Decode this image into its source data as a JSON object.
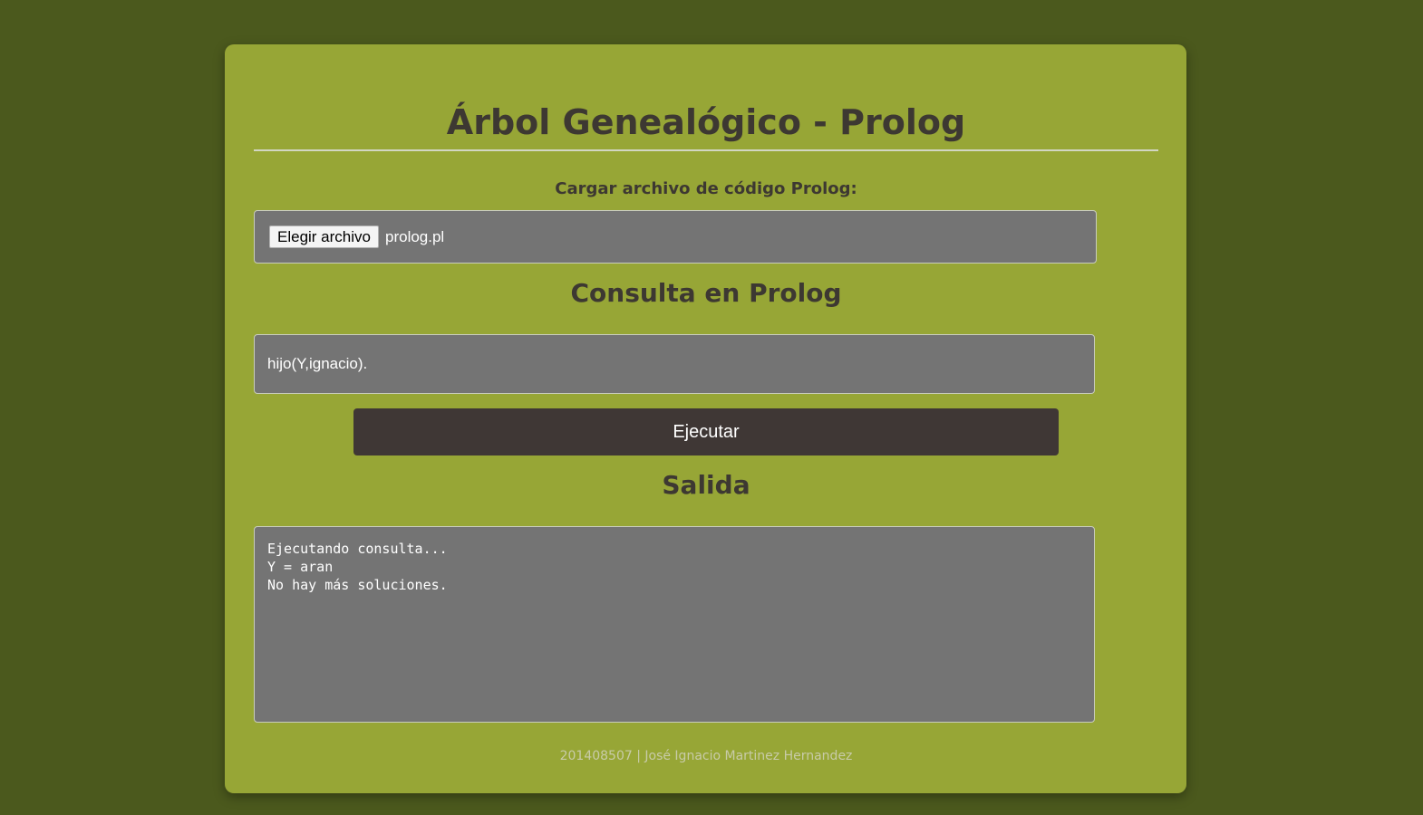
{
  "page": {
    "title": "Árbol Genealógico - Prolog",
    "colors": {
      "background": "#4b591d",
      "card": "#97a636",
      "text": "#3d3832",
      "field": "#747474",
      "button": "#3f3735"
    }
  },
  "upload": {
    "label": "Cargar archivo de código Prolog:",
    "button_label": "Elegir archivo",
    "file_name": "prolog.pl"
  },
  "query": {
    "heading": "Consulta en Prolog",
    "value": "hijo(Y,ignacio).",
    "run_label": "Ejecutar"
  },
  "output": {
    "heading": "Salida",
    "text": "Ejecutando consulta...\nY = aran\nNo hay más soluciones."
  },
  "footer": {
    "text": "201408507 | José Ignacio Martinez Hernandez"
  }
}
